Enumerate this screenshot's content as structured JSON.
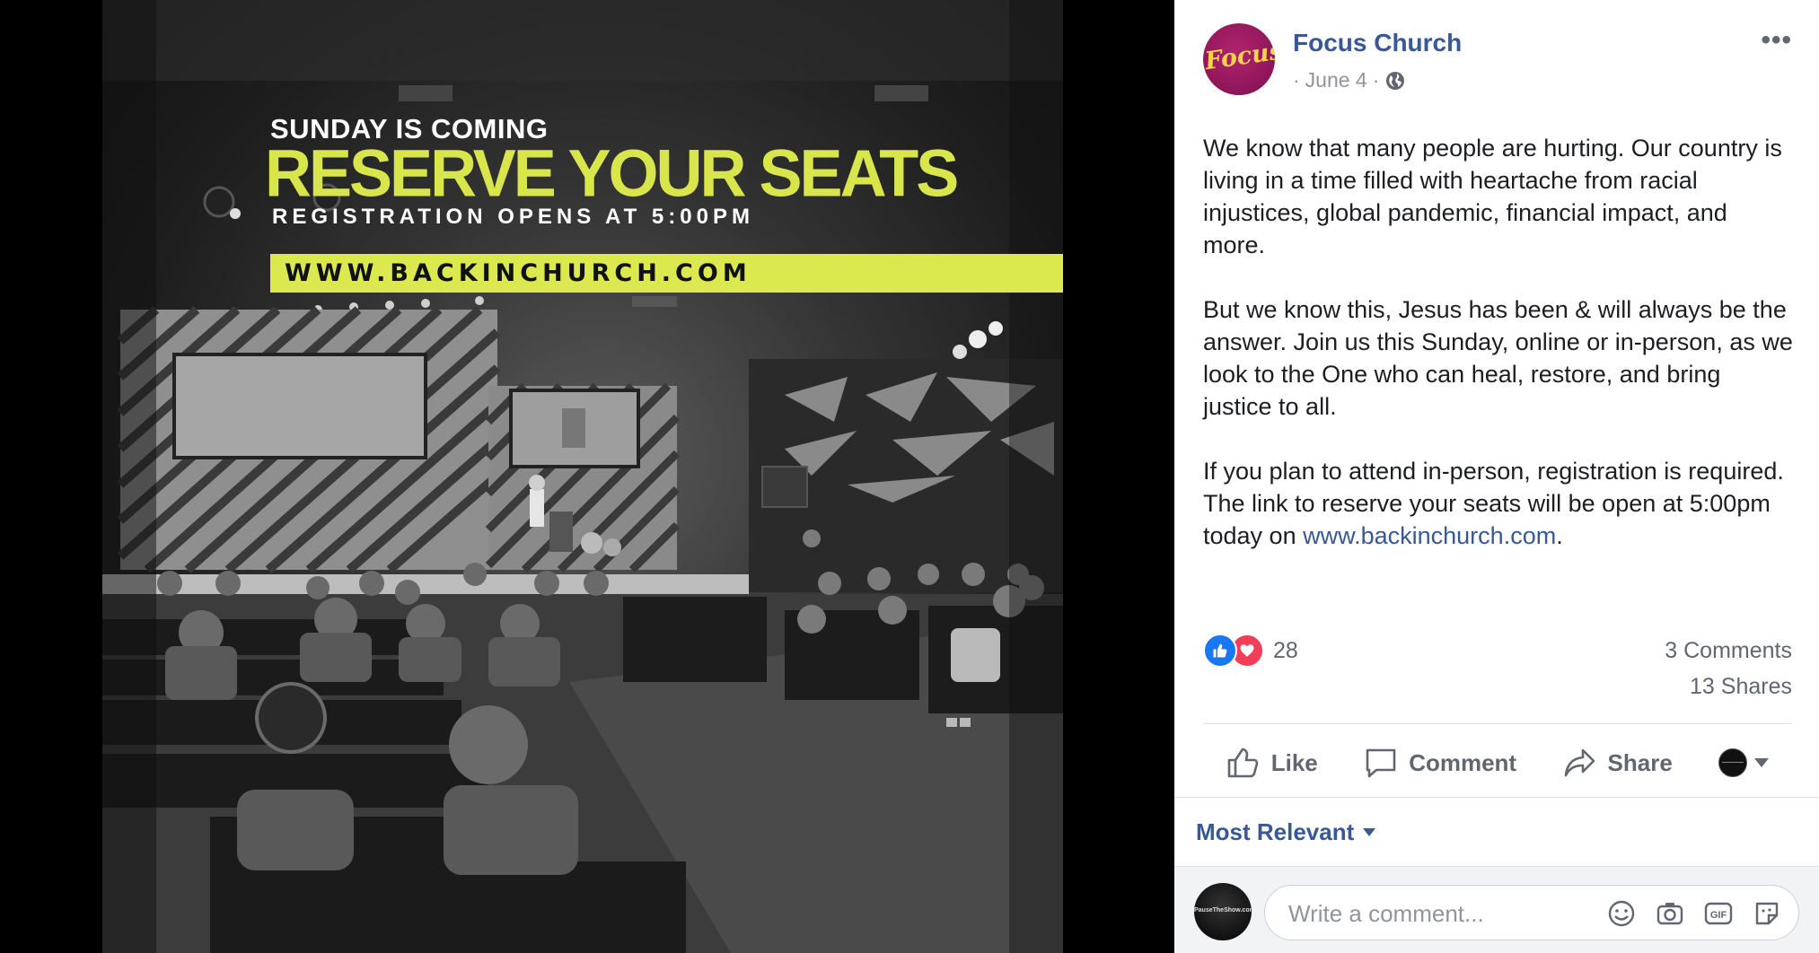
{
  "promo_image": {
    "headline_small": "SUNDAY IS COMING",
    "headline_large": "RESERVE YOUR SEATS",
    "subheadline": "REGISTRATION OPENS AT 5:00PM",
    "url_banner": "WWW.BACKINCHURCH.COM",
    "accent_color": "#dbe94f"
  },
  "post": {
    "page_name": "Focus Church",
    "avatar_text": "Focus",
    "date_prefix": "·",
    "date": "June 4",
    "date_suffix": "·",
    "audience_icon": "globe-icon",
    "more_label": "•••",
    "paragraphs": [
      "We know that many people are hurting. Our country is living in a time filled with heartache from racial injustices, global pandemic, financial impact, and more.",
      "But we know this, Jesus has been & will always be the answer. Join us this Sunday, online or in-person, as we look to the One who can heal, restore, and bring justice to all."
    ],
    "last_paragraph_text": "If you plan to attend in-person, registration is required. The link to reserve your seats will be open at 5:00pm today on ",
    "last_paragraph_link": "www.backinchurch.com",
    "last_paragraph_end": ".",
    "link_color": "#385898"
  },
  "engagement": {
    "reaction_icons": [
      "like-icon",
      "love-icon"
    ],
    "reaction_count": "28",
    "comments": "3 Comments",
    "shares": "13 Shares"
  },
  "actions": {
    "like": "Like",
    "comment": "Comment",
    "share": "Share"
  },
  "comments_section": {
    "sort_label": "Most Relevant",
    "input_placeholder": "Write a comment...",
    "commenter_avatar_text": "PauseTheShow.com",
    "tools": [
      "emoji-icon",
      "camera-icon",
      "gif-icon",
      "sticker-icon"
    ],
    "gif_label": "GIF"
  }
}
